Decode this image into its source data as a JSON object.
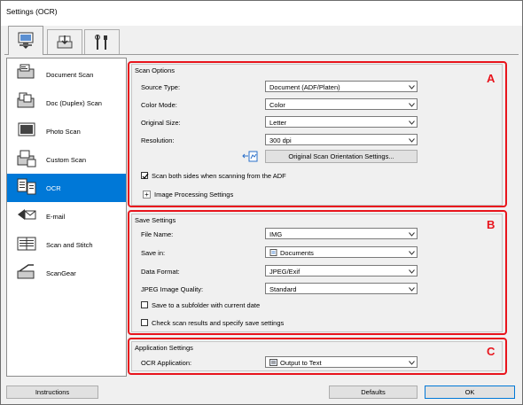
{
  "window": {
    "title": "Settings (OCR)"
  },
  "tabs": [
    {
      "name": "scan-from-computer",
      "icon": "computer-scan-icon"
    },
    {
      "name": "scan-from-panel",
      "icon": "panel-scan-icon"
    },
    {
      "name": "general-settings",
      "icon": "tools-icon"
    }
  ],
  "sidebar": {
    "items": [
      {
        "label": "Document Scan",
        "icon": "document-scan-icon"
      },
      {
        "label": "Doc (Duplex) Scan",
        "icon": "duplex-scan-icon"
      },
      {
        "label": "Photo Scan",
        "icon": "photo-scan-icon"
      },
      {
        "label": "Custom Scan",
        "icon": "custom-scan-icon"
      },
      {
        "label": "OCR",
        "icon": "ocr-icon",
        "selected": true
      },
      {
        "label": "E-mail",
        "icon": "email-icon"
      },
      {
        "label": "Scan and Stitch",
        "icon": "stitch-icon"
      },
      {
        "label": "ScanGear",
        "icon": "scangear-icon"
      }
    ]
  },
  "scan_options": {
    "title": "Scan Options",
    "letter": "A",
    "source_type": {
      "label": "Source Type:",
      "value": "Document (ADF/Platen)"
    },
    "color_mode": {
      "label": "Color Mode:",
      "value": "Color"
    },
    "original_size": {
      "label": "Original Size:",
      "value": "Letter"
    },
    "resolution": {
      "label": "Resolution:",
      "value": "300 dpi"
    },
    "orientation_button": "Original Scan Orientation Settings...",
    "both_sides": {
      "label": "Scan both sides when scanning from the ADF",
      "checked": true
    },
    "image_processing": {
      "label": "Image Processing Settings",
      "expander": "+"
    }
  },
  "save_settings": {
    "title": "Save Settings",
    "letter": "B",
    "file_name": {
      "label": "File Name:",
      "value": "IMG"
    },
    "save_in": {
      "label": "Save in:",
      "value": "Documents"
    },
    "data_format": {
      "label": "Data Format:",
      "value": "JPEG/Exif"
    },
    "jpeg_quality": {
      "label": "JPEG Image Quality:",
      "value": "Standard"
    },
    "subfolder": {
      "label": "Save to a subfolder with current date",
      "checked": false
    },
    "check_results": {
      "label": "Check scan results and specify save settings",
      "checked": false
    }
  },
  "app_settings": {
    "title": "Application Settings",
    "letter": "C",
    "ocr_app": {
      "label": "OCR Application:",
      "value": "Output to Text"
    }
  },
  "footer": {
    "instructions": "Instructions",
    "defaults": "Defaults",
    "ok": "OK"
  },
  "colors": {
    "selected": "#0078d7",
    "highlight_box": "#e8141c"
  }
}
